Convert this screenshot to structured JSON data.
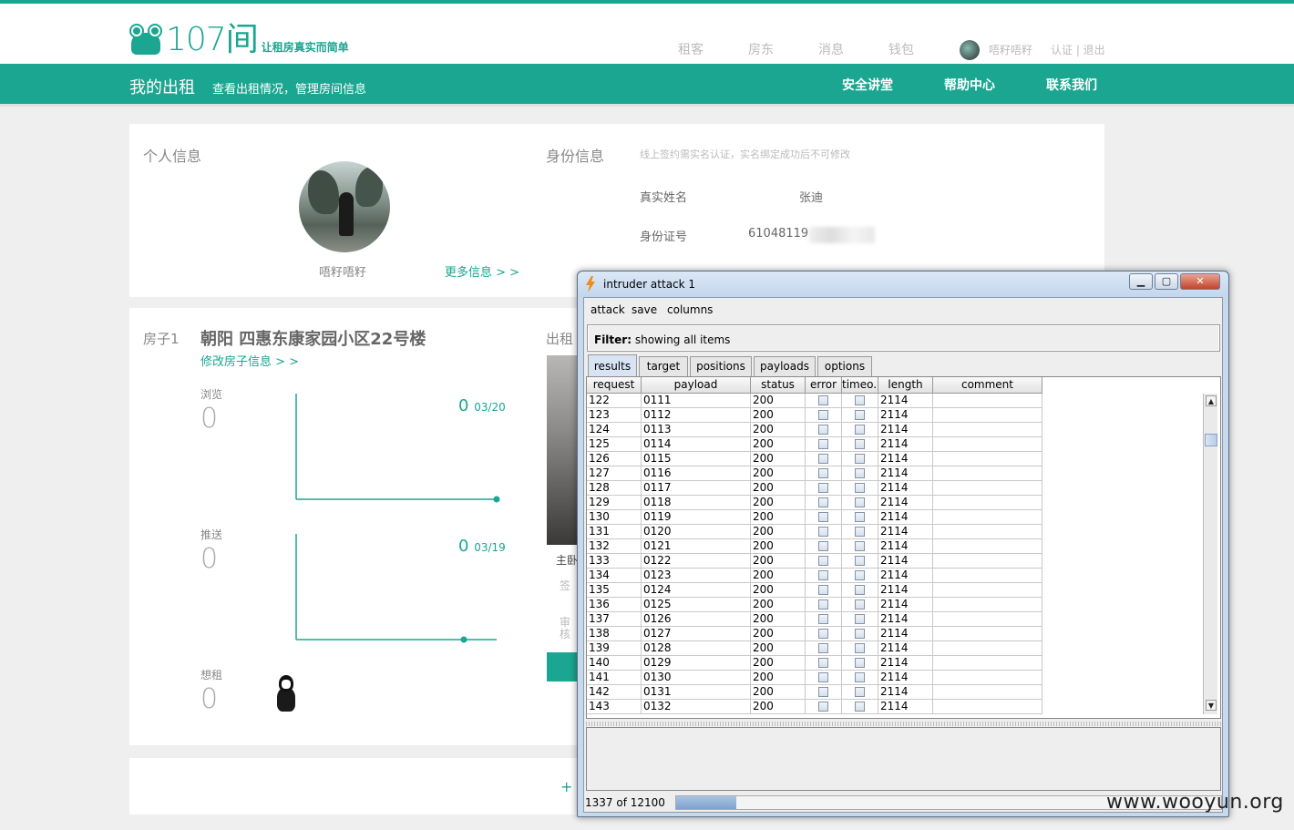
{
  "site": {
    "logo_text": "107间",
    "slogan": "让租房真实而简单",
    "nav": [
      "租客",
      "房东",
      "消息",
      "钱包"
    ],
    "username": "唔籽唔籽",
    "auth_links": "认证 | 退出",
    "accent_color": "#1aa690"
  },
  "subbar": {
    "title": "我的出租",
    "desc": "查看出租情况，管理房间信息",
    "links": [
      "安全讲堂",
      "帮助中心",
      "联系我们"
    ]
  },
  "profile": {
    "section": "个人信息",
    "name": "唔籽唔籽",
    "more": "更多信息 > >"
  },
  "identity": {
    "section": "身份信息",
    "hint": "线上签约需实名认证，实名绑定成功后不可修改",
    "name_label": "真实姓名",
    "name_value": "张迪",
    "id_label": "身份证号",
    "id_value": "61048119"
  },
  "house": {
    "label": "房子1",
    "title": "朝阳 四惠东康家园小区22号楼",
    "edit": "修改房子信息 > >",
    "stats": [
      {
        "label": "浏览",
        "value": "0",
        "chart_value": "0",
        "date": "03/20"
      },
      {
        "label": "推送",
        "value": "0",
        "chart_value": "0",
        "date": "03/19"
      },
      {
        "label": "想租",
        "value": "0"
      }
    ],
    "rent_label": "出租",
    "rent_text1": "主卧",
    "rent_text2": "签",
    "rent_text3": "审",
    "rent_text4": "核"
  },
  "add_plus": "+",
  "intruder": {
    "title": "intruder attack 1",
    "menu": [
      "attack",
      "save",
      "columns"
    ],
    "filter_label": "Filter:",
    "filter_value": "showing all items",
    "tabs": [
      "results",
      "target",
      "positions",
      "payloads",
      "options"
    ],
    "columns": [
      "request",
      "payload",
      "status",
      "error",
      "timeo...",
      "length",
      "comment"
    ],
    "rows": [
      [
        "122",
        "0111",
        "200",
        "2114"
      ],
      [
        "123",
        "0112",
        "200",
        "2114"
      ],
      [
        "124",
        "0113",
        "200",
        "2114"
      ],
      [
        "125",
        "0114",
        "200",
        "2114"
      ],
      [
        "126",
        "0115",
        "200",
        "2114"
      ],
      [
        "127",
        "0116",
        "200",
        "2114"
      ],
      [
        "128",
        "0117",
        "200",
        "2114"
      ],
      [
        "129",
        "0118",
        "200",
        "2114"
      ],
      [
        "130",
        "0119",
        "200",
        "2114"
      ],
      [
        "131",
        "0120",
        "200",
        "2114"
      ],
      [
        "132",
        "0121",
        "200",
        "2114"
      ],
      [
        "133",
        "0122",
        "200",
        "2114"
      ],
      [
        "134",
        "0123",
        "200",
        "2114"
      ],
      [
        "135",
        "0124",
        "200",
        "2114"
      ],
      [
        "136",
        "0125",
        "200",
        "2114"
      ],
      [
        "137",
        "0126",
        "200",
        "2114"
      ],
      [
        "138",
        "0127",
        "200",
        "2114"
      ],
      [
        "139",
        "0128",
        "200",
        "2114"
      ],
      [
        "140",
        "0129",
        "200",
        "2114"
      ],
      [
        "141",
        "0130",
        "200",
        "2114"
      ],
      [
        "142",
        "0131",
        "200",
        "2114"
      ],
      [
        "143",
        "0132",
        "200",
        "2114"
      ]
    ],
    "status": "1337 of 12100",
    "progress_fraction": 0.1105
  },
  "watermark": "www.wooyun.org"
}
